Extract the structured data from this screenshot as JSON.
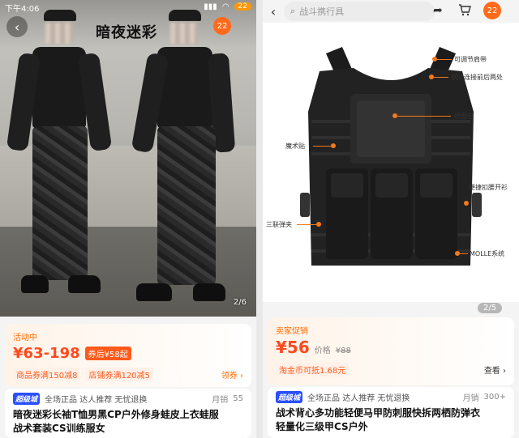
{
  "left": {
    "status_time": "下午4:06",
    "status_right": "",
    "battery": "22",
    "photo_title": "暗夜迷彩",
    "cart_badge": "22",
    "page_indicator": "2/6",
    "promo_label": "活动中",
    "price_range": "¥63-198",
    "coupon_text": "券后¥58起",
    "coupon_pill_1": "商品券满150减8",
    "coupon_pill_2": "店铺券满120减5",
    "coupon_link": "领券 ›",
    "tmall_label": "超级城",
    "service_text": "全场正品 达人推荐 无忧退换",
    "monthly_label": "月销",
    "monthly_count": "55",
    "title_line1": "暗夜迷彩长袖T恤男黑CP户外修身蛙皮上衣蛙服",
    "title_line2": "战术套装CS训练服女"
  },
  "right": {
    "search_placeholder": "战斗携行具",
    "cart_badge": "22",
    "page_indicator": "2/5",
    "annotations": {
      "a1": "可调节肩带",
      "a2": "钢丝连接前后两处",
      "a3": "地图包",
      "a4": "魔术贴",
      "a5": "便捷扣腰开衫",
      "a6": "三联弹夹",
      "a7": "MOLLE系统"
    },
    "promo_label": "卖家促销",
    "price": "¥56",
    "orig_price_label": "价格",
    "orig_price": "¥88",
    "coin_text": "淘金币可抵1.68元",
    "view_link": "查看 ›",
    "tmall_label": "超级城",
    "service_text": "全场正品 达人推荐 无忧退换",
    "monthly_label": "月销",
    "monthly_count": "300+",
    "title_line1": "战术背心多功能轻便马甲防刺服快拆两栖防弹衣",
    "title_line2": "轻量化三级甲CS户外"
  },
  "colors": {
    "accent": "#ff6a1a",
    "price": "#ff4a1f",
    "tmall_blue": "#2a4fff"
  }
}
